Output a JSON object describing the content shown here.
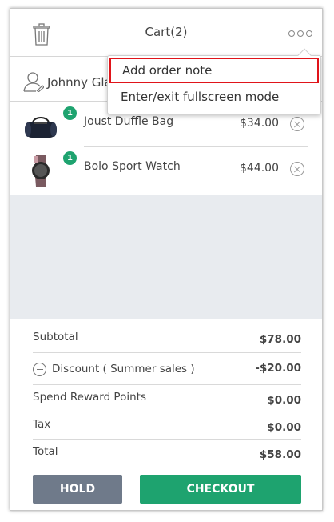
{
  "header": {
    "title": "Cart(2)",
    "trash_icon": "trash-icon",
    "more_icon": "more-options-icon"
  },
  "customer": {
    "name": "Johnny Gla",
    "icon": "user-icon"
  },
  "menu": {
    "items": [
      {
        "label": "Add order note"
      },
      {
        "label": "Enter/exit fullscreen mode"
      }
    ],
    "highlight_color": "#e0141a"
  },
  "cart_items": [
    {
      "qty": "1",
      "name": "Joust Duffle Bag",
      "price": "$34.00",
      "icon": "duffle-bag-icon"
    },
    {
      "qty": "1",
      "name": "Bolo Sport Watch",
      "price": "$44.00",
      "icon": "sport-watch-icon"
    }
  ],
  "totals": {
    "subtotal_label": "Subtotal",
    "subtotal_value": "$78.00",
    "discount_label": "Discount ( Summer sales )",
    "discount_value": "-$20.00",
    "reward_label": "Spend Reward Points",
    "reward_value": "$0.00",
    "tax_label": "Tax",
    "tax_value": "$0.00",
    "total_label": "Total",
    "total_value": "$58.00"
  },
  "buttons": {
    "hold": "HOLD",
    "checkout": "CHECKOUT"
  },
  "colors": {
    "accent_green": "#1ea36f",
    "hold_gray": "#6f7a8a",
    "empty_area": "#e8ebef"
  }
}
